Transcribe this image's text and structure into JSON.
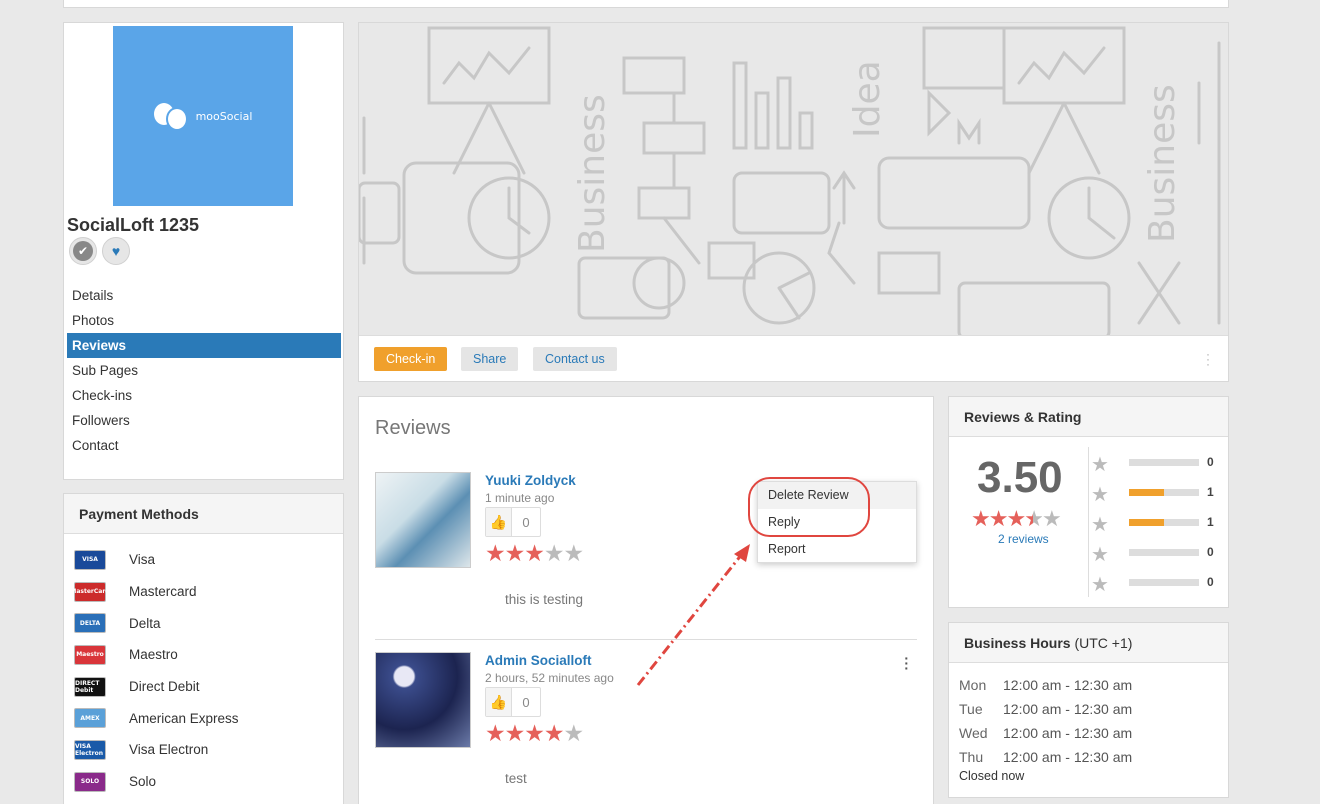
{
  "profile": {
    "logo_text": "mooSocial",
    "name": "SocialLoft 1235",
    "nav": [
      {
        "label": "Details",
        "active": false
      },
      {
        "label": "Photos",
        "active": false
      },
      {
        "label": "Reviews",
        "active": true
      },
      {
        "label": "Sub Pages",
        "active": false
      },
      {
        "label": "Check-ins",
        "active": false
      },
      {
        "label": "Followers",
        "active": false
      },
      {
        "label": "Contact",
        "active": false
      }
    ]
  },
  "payment_methods": {
    "title": "Payment Methods",
    "items": [
      {
        "label": "Visa",
        "icon": "visa-card-icon",
        "icon_text": "VISA",
        "color": "#1a4a9a"
      },
      {
        "label": "Mastercard",
        "icon": "mastercard-icon",
        "icon_text": "MasterCard",
        "color": "#cc2b2b"
      },
      {
        "label": "Delta",
        "icon": "delta-card-icon",
        "icon_text": "DELTA",
        "color": "#2a6fb8"
      },
      {
        "label": "Maestro",
        "icon": "maestro-card-icon",
        "icon_text": "Maestro",
        "color": "#d9353a"
      },
      {
        "label": "Direct Debit",
        "icon": "direct-debit-icon",
        "icon_text": "DIRECT Debit",
        "color": "#111111"
      },
      {
        "label": "American Express",
        "icon": "amex-card-icon",
        "icon_text": "AMEX",
        "color": "#5aa0d8"
      },
      {
        "label": "Visa Electron",
        "icon": "visa-electron-icon",
        "icon_text": "VISA Electron",
        "color": "#1a5aa8"
      },
      {
        "label": "Solo",
        "icon": "solo-card-icon",
        "icon_text": "SOLO",
        "color": "#8a2a8a"
      }
    ]
  },
  "cover": {
    "buttons": {
      "checkin": "Check-in",
      "share": "Share",
      "contact": "Contact us"
    },
    "art_words": [
      "Business",
      "Idea",
      "Business"
    ]
  },
  "reviews": {
    "title": "Reviews",
    "items": [
      {
        "author": "Yuuki Zoldyck",
        "time": "1 minute ago",
        "likes": "0",
        "rating": 3,
        "text": "this is testing"
      },
      {
        "author": "Admin Socialloft",
        "time": "2 hours, 52 minutes ago",
        "likes": "0",
        "rating": 4,
        "text": "test"
      }
    ],
    "menu": [
      "Delete Review",
      "Reply",
      "Report"
    ]
  },
  "ratings": {
    "title": "Reviews & Rating",
    "score": "3.50",
    "average": 3.5,
    "count_label": "2 reviews",
    "rows": [
      {
        "count": "0",
        "fraction": 0
      },
      {
        "count": "1",
        "fraction": 0.5
      },
      {
        "count": "1",
        "fraction": 0.5
      },
      {
        "count": "0",
        "fraction": 0
      },
      {
        "count": "0",
        "fraction": 0
      }
    ]
  },
  "hours": {
    "title": "Business Hours",
    "timezone": "(UTC +1)",
    "rows": [
      {
        "day": "Mon",
        "time": "12:00 am - 12:30 am"
      },
      {
        "day": "Tue",
        "time": "12:00 am - 12:30 am"
      },
      {
        "day": "Wed",
        "time": "12:00 am - 12:30 am"
      },
      {
        "day": "Thu",
        "time": "12:00 am - 12:30 am"
      }
    ],
    "status": "Closed now"
  },
  "colors": {
    "accent_blue": "#2a7ab8",
    "checkin_orange": "#f0a02c",
    "star_red": "#e5605a",
    "annotation_red": "#e0463f",
    "logo_blue": "#5aa5e8"
  }
}
